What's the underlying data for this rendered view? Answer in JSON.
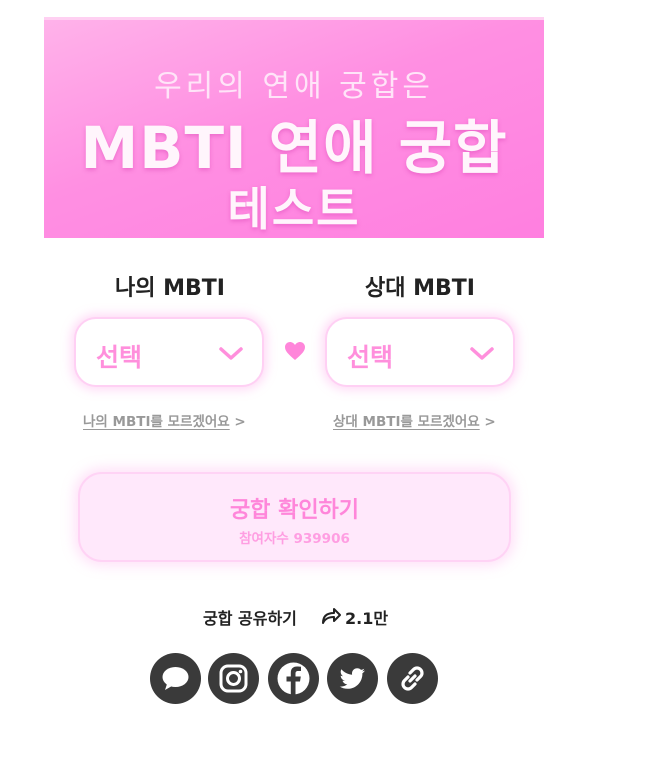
{
  "banner": {
    "subtitle": "우리의 연애 궁합은",
    "title_line1": "MBTI 연애 궁합",
    "title_line2": "테스트"
  },
  "selectors": {
    "mine": {
      "label": "나의 MBTI",
      "value": "선택",
      "help_link": "나의 MBTI를 모르겠어요",
      "help_arrow": ">"
    },
    "partner": {
      "label": "상대 MBTI",
      "value": "선택",
      "help_link": "상대 MBTI를 모르겠어요",
      "help_arrow": ">"
    }
  },
  "cta": {
    "label": "궁합 확인하기",
    "participants": "참여자수 939906"
  },
  "share": {
    "label": "궁합 공유하기",
    "count": "2.1만",
    "icons": [
      "kakao-talk-icon",
      "instagram-icon",
      "facebook-icon",
      "twitter-icon",
      "link-icon"
    ]
  },
  "colors": {
    "accent_pink": "#ff86da",
    "banner_gradient_start": "#ffb3ea",
    "banner_gradient_end": "#ff7fe0",
    "social_bg": "#3a3a3a"
  }
}
